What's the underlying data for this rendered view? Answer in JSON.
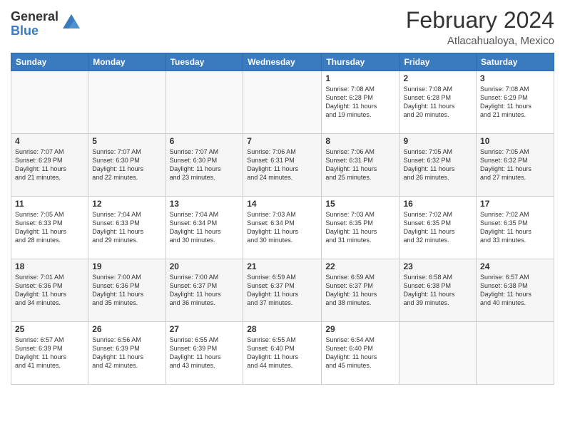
{
  "logo": {
    "general": "General",
    "blue": "Blue"
  },
  "header": {
    "month": "February 2024",
    "location": "Atlacahualoya, Mexico"
  },
  "weekdays": [
    "Sunday",
    "Monday",
    "Tuesday",
    "Wednesday",
    "Thursday",
    "Friday",
    "Saturday"
  ],
  "weeks": [
    [
      {
        "day": "",
        "info": ""
      },
      {
        "day": "",
        "info": ""
      },
      {
        "day": "",
        "info": ""
      },
      {
        "day": "",
        "info": ""
      },
      {
        "day": "1",
        "info": "Sunrise: 7:08 AM\nSunset: 6:28 PM\nDaylight: 11 hours\nand 19 minutes."
      },
      {
        "day": "2",
        "info": "Sunrise: 7:08 AM\nSunset: 6:28 PM\nDaylight: 11 hours\nand 20 minutes."
      },
      {
        "day": "3",
        "info": "Sunrise: 7:08 AM\nSunset: 6:29 PM\nDaylight: 11 hours\nand 21 minutes."
      }
    ],
    [
      {
        "day": "4",
        "info": "Sunrise: 7:07 AM\nSunset: 6:29 PM\nDaylight: 11 hours\nand 21 minutes."
      },
      {
        "day": "5",
        "info": "Sunrise: 7:07 AM\nSunset: 6:30 PM\nDaylight: 11 hours\nand 22 minutes."
      },
      {
        "day": "6",
        "info": "Sunrise: 7:07 AM\nSunset: 6:30 PM\nDaylight: 11 hours\nand 23 minutes."
      },
      {
        "day": "7",
        "info": "Sunrise: 7:06 AM\nSunset: 6:31 PM\nDaylight: 11 hours\nand 24 minutes."
      },
      {
        "day": "8",
        "info": "Sunrise: 7:06 AM\nSunset: 6:31 PM\nDaylight: 11 hours\nand 25 minutes."
      },
      {
        "day": "9",
        "info": "Sunrise: 7:05 AM\nSunset: 6:32 PM\nDaylight: 11 hours\nand 26 minutes."
      },
      {
        "day": "10",
        "info": "Sunrise: 7:05 AM\nSunset: 6:32 PM\nDaylight: 11 hours\nand 27 minutes."
      }
    ],
    [
      {
        "day": "11",
        "info": "Sunrise: 7:05 AM\nSunset: 6:33 PM\nDaylight: 11 hours\nand 28 minutes."
      },
      {
        "day": "12",
        "info": "Sunrise: 7:04 AM\nSunset: 6:33 PM\nDaylight: 11 hours\nand 29 minutes."
      },
      {
        "day": "13",
        "info": "Sunrise: 7:04 AM\nSunset: 6:34 PM\nDaylight: 11 hours\nand 30 minutes."
      },
      {
        "day": "14",
        "info": "Sunrise: 7:03 AM\nSunset: 6:34 PM\nDaylight: 11 hours\nand 30 minutes."
      },
      {
        "day": "15",
        "info": "Sunrise: 7:03 AM\nSunset: 6:35 PM\nDaylight: 11 hours\nand 31 minutes."
      },
      {
        "day": "16",
        "info": "Sunrise: 7:02 AM\nSunset: 6:35 PM\nDaylight: 11 hours\nand 32 minutes."
      },
      {
        "day": "17",
        "info": "Sunrise: 7:02 AM\nSunset: 6:35 PM\nDaylight: 11 hours\nand 33 minutes."
      }
    ],
    [
      {
        "day": "18",
        "info": "Sunrise: 7:01 AM\nSunset: 6:36 PM\nDaylight: 11 hours\nand 34 minutes."
      },
      {
        "day": "19",
        "info": "Sunrise: 7:00 AM\nSunset: 6:36 PM\nDaylight: 11 hours\nand 35 minutes."
      },
      {
        "day": "20",
        "info": "Sunrise: 7:00 AM\nSunset: 6:37 PM\nDaylight: 11 hours\nand 36 minutes."
      },
      {
        "day": "21",
        "info": "Sunrise: 6:59 AM\nSunset: 6:37 PM\nDaylight: 11 hours\nand 37 minutes."
      },
      {
        "day": "22",
        "info": "Sunrise: 6:59 AM\nSunset: 6:37 PM\nDaylight: 11 hours\nand 38 minutes."
      },
      {
        "day": "23",
        "info": "Sunrise: 6:58 AM\nSunset: 6:38 PM\nDaylight: 11 hours\nand 39 minutes."
      },
      {
        "day": "24",
        "info": "Sunrise: 6:57 AM\nSunset: 6:38 PM\nDaylight: 11 hours\nand 40 minutes."
      }
    ],
    [
      {
        "day": "25",
        "info": "Sunrise: 6:57 AM\nSunset: 6:39 PM\nDaylight: 11 hours\nand 41 minutes."
      },
      {
        "day": "26",
        "info": "Sunrise: 6:56 AM\nSunset: 6:39 PM\nDaylight: 11 hours\nand 42 minutes."
      },
      {
        "day": "27",
        "info": "Sunrise: 6:55 AM\nSunset: 6:39 PM\nDaylight: 11 hours\nand 43 minutes."
      },
      {
        "day": "28",
        "info": "Sunrise: 6:55 AM\nSunset: 6:40 PM\nDaylight: 11 hours\nand 44 minutes."
      },
      {
        "day": "29",
        "info": "Sunrise: 6:54 AM\nSunset: 6:40 PM\nDaylight: 11 hours\nand 45 minutes."
      },
      {
        "day": "",
        "info": ""
      },
      {
        "day": "",
        "info": ""
      }
    ]
  ],
  "colors": {
    "header_bg": "#3a7abf",
    "accent": "#3a7abf"
  }
}
